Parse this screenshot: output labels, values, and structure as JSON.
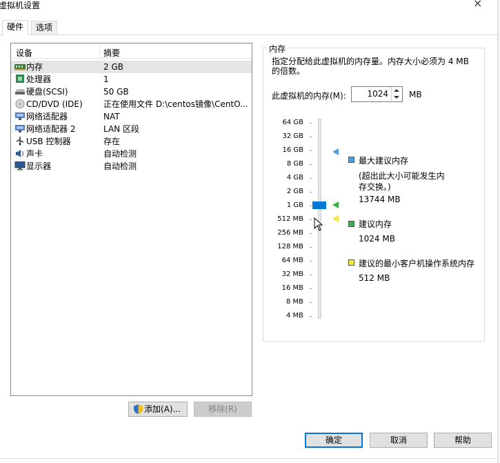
{
  "window": {
    "title": "虚拟机设置",
    "close_glyph": "×"
  },
  "tabs": [
    {
      "label": "硬件"
    },
    {
      "label": "选项"
    }
  ],
  "device_list": {
    "columns": {
      "device": "设备",
      "summary": "摘要"
    },
    "rows": [
      {
        "name": "内存",
        "summary": "2 GB",
        "icon": "memory-icon",
        "selected": true
      },
      {
        "name": "处理器",
        "summary": "1",
        "icon": "processor-icon"
      },
      {
        "name": "硬盘(SCSI)",
        "summary": "50 GB",
        "icon": "hard-disk-icon"
      },
      {
        "name": "CD/DVD (IDE)",
        "summary": "正在使用文件 D:\\centos镜像\\CentO...",
        "icon": "cd-dvd-icon"
      },
      {
        "name": "网络适配器",
        "summary": "NAT",
        "icon": "network-adapter-icon"
      },
      {
        "name": "网络适配器 2",
        "summary": "LAN 区段",
        "icon": "network-adapter-icon"
      },
      {
        "name": "USB 控制器",
        "summary": "存在",
        "icon": "usb-icon"
      },
      {
        "name": "声卡",
        "summary": "自动检测",
        "icon": "sound-card-icon"
      },
      {
        "name": "显示器",
        "summary": "自动检测",
        "icon": "display-icon"
      }
    ]
  },
  "buttons": {
    "add": "添加(A)...",
    "remove": "移除(R)",
    "ok": "确定",
    "cancel": "取消",
    "help": "帮助"
  },
  "memory": {
    "group_title": "内存",
    "description": "指定分配给此虚拟机的内存量。内存大小必须为 4 MB 的倍数。",
    "field_label": "此虚拟机的内存(M):",
    "value": "1024",
    "unit": "MB",
    "scale": [
      "64 GB",
      "32 GB",
      "16 GB",
      "8 GB",
      "4 GB",
      "2 GB",
      "1 GB",
      "512 MB",
      "256 MB",
      "128 MB",
      "64 MB",
      "32 MB",
      "16 MB",
      "8 MB",
      "4 MB"
    ],
    "legend": {
      "max": {
        "title": "最大建议内存",
        "note": "(超出此大小可能发生内存交换。)",
        "value": "13744 MB",
        "color": "#5b9bd5"
      },
      "recommended": {
        "title": "建议内存",
        "value": "1024 MB",
        "color": "#3cb043"
      },
      "min": {
        "title": "建议的最小客户机操作系统内存",
        "value": "512 MB",
        "color": "#f5e642"
      }
    }
  }
}
